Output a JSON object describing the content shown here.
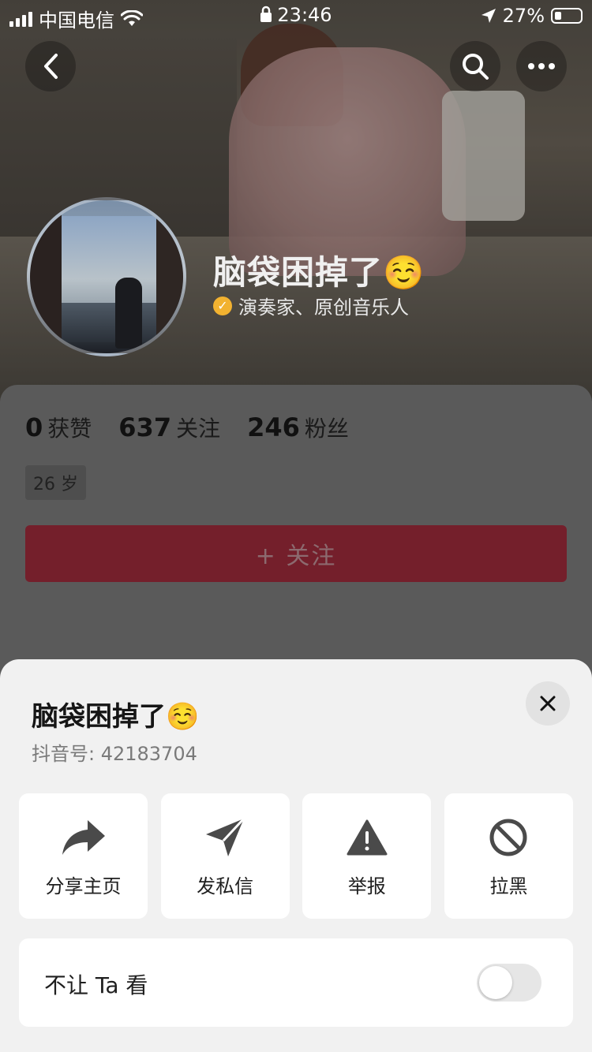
{
  "status_bar": {
    "carrier": "中国电信",
    "time": "23:46",
    "battery": "27%"
  },
  "profile": {
    "name": "脑袋困掉了☺️",
    "verification": "演奏家、原创音乐人",
    "stats": [
      {
        "value": "0",
        "label": "获赞"
      },
      {
        "value": "637",
        "label": "关注"
      },
      {
        "value": "246",
        "label": "粉丝"
      }
    ],
    "age_tag": "26 岁",
    "follow_label": "+ 关注"
  },
  "sheet": {
    "title": "脑袋困掉了☺️",
    "douyin_id": "抖音号: 42183704",
    "actions": [
      {
        "label": "分享主页",
        "icon": "share-arrow-icon"
      },
      {
        "label": "发私信",
        "icon": "paper-plane-icon"
      },
      {
        "label": "举报",
        "icon": "warning-triangle-icon"
      },
      {
        "label": "拉黑",
        "icon": "block-icon"
      }
    ],
    "hide_label": "不让 Ta 看",
    "hide_toggle_on": false
  }
}
